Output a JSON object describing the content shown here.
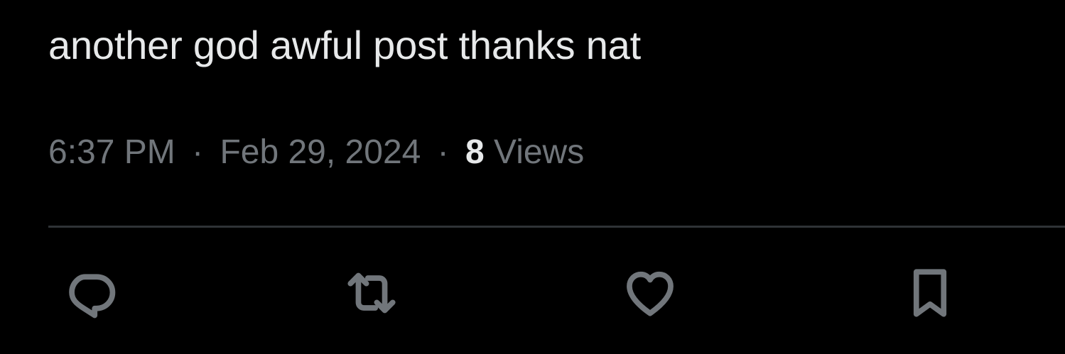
{
  "tweet": {
    "text": "another god awful post thanks nat",
    "time": "6:37 PM",
    "separator": "·",
    "date": "Feb 29, 2024",
    "views_count": "8",
    "views_label": "Views"
  },
  "actions": [
    {
      "name": "reply",
      "icon": "reply-icon"
    },
    {
      "name": "repost",
      "icon": "repost-icon"
    },
    {
      "name": "like",
      "icon": "heart-icon"
    },
    {
      "name": "bookmark",
      "icon": "bookmark-icon"
    }
  ],
  "colors": {
    "background": "#000000",
    "primary_text": "#e7e9ea",
    "secondary_text": "#71767b",
    "divider": "#2f3336"
  }
}
